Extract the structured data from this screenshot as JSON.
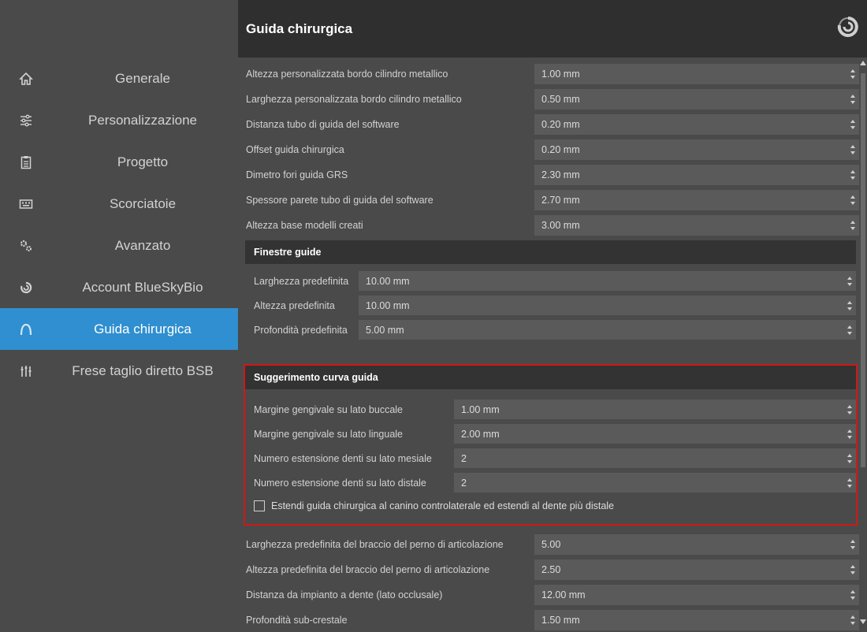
{
  "sidebar": {
    "items": [
      {
        "label": "Generale",
        "icon": "home-icon",
        "active": false
      },
      {
        "label": "Personalizzazione",
        "icon": "sliders-icon",
        "active": false
      },
      {
        "label": "Progetto",
        "icon": "clipboard-icon",
        "active": false
      },
      {
        "label": "Scorciatoie",
        "icon": "keyboard-icon",
        "active": false
      },
      {
        "label": "Avanzato",
        "icon": "gears-icon",
        "active": false
      },
      {
        "label": "Account BlueSkyBio",
        "icon": "blueskybio-logo-icon",
        "active": false
      },
      {
        "label": "Guida chirurgica",
        "icon": "surgical-guide-icon",
        "active": true
      },
      {
        "label": "Frese taglio diretto BSB",
        "icon": "drill-icon",
        "active": false
      }
    ]
  },
  "header": {
    "title": "Guida chirurgica",
    "logo": "blueskybio-logo-icon"
  },
  "settings_top": [
    {
      "label": "Altezza personalizzata bordo cilindro metallico",
      "value": "1.00 mm"
    },
    {
      "label": "Larghezza personalizzata bordo cilindro metallico",
      "value": "0.50 mm"
    },
    {
      "label": "Distanza tubo di guida del software",
      "value": "0.20 mm"
    },
    {
      "label": "Offset guida chirurgica",
      "value": "0.20 mm"
    },
    {
      "label": "Dimetro fori guida GRS",
      "value": "2.30 mm"
    },
    {
      "label": "Spessore parete tubo di guida del software",
      "value": "2.70 mm"
    },
    {
      "label": "Altezza base modelli creati",
      "value": "3.00 mm"
    }
  ],
  "finestre": {
    "title": "Finestre guide",
    "rows": [
      {
        "label": "Larghezza predefinita",
        "value": "10.00 mm"
      },
      {
        "label": "Altezza predefinita",
        "value": "10.00 mm"
      },
      {
        "label": "Profondità predefinita",
        "value": "5.00 mm"
      }
    ]
  },
  "suggerimento": {
    "title": "Suggerimento curva guida",
    "rows": [
      {
        "label": "Margine gengivale su lato buccale",
        "value": "1.00 mm"
      },
      {
        "label": "Margine gengivale su lato linguale",
        "value": "2.00 mm"
      },
      {
        "label": "Numero estensione denti su lato mesiale",
        "value": "2"
      },
      {
        "label": "Numero estensione denti su lato distale",
        "value": "2"
      }
    ],
    "checkbox_label": "Estendi guida chirurgica al canino controlaterale ed estendi al dente più distale",
    "checkbox_checked": false
  },
  "settings_bottom": [
    {
      "label": "Larghezza predefinita del braccio del perno di articolazione",
      "value": "5.00"
    },
    {
      "label": "Altezza predefinita del braccio del perno di articolazione",
      "value": "2.50"
    },
    {
      "label": "Distanza da impianto a dente (lato occlusale)",
      "value": "12.00 mm"
    },
    {
      "label": "Profondità sub-crestale",
      "value": "1.50 mm"
    }
  ],
  "colors": {
    "accent": "#2f8fd0",
    "highlight": "#d01818",
    "header_bg": "#2f2f2f",
    "panel_bg": "#4a4a4a",
    "field_bg": "#5a5a5a"
  }
}
